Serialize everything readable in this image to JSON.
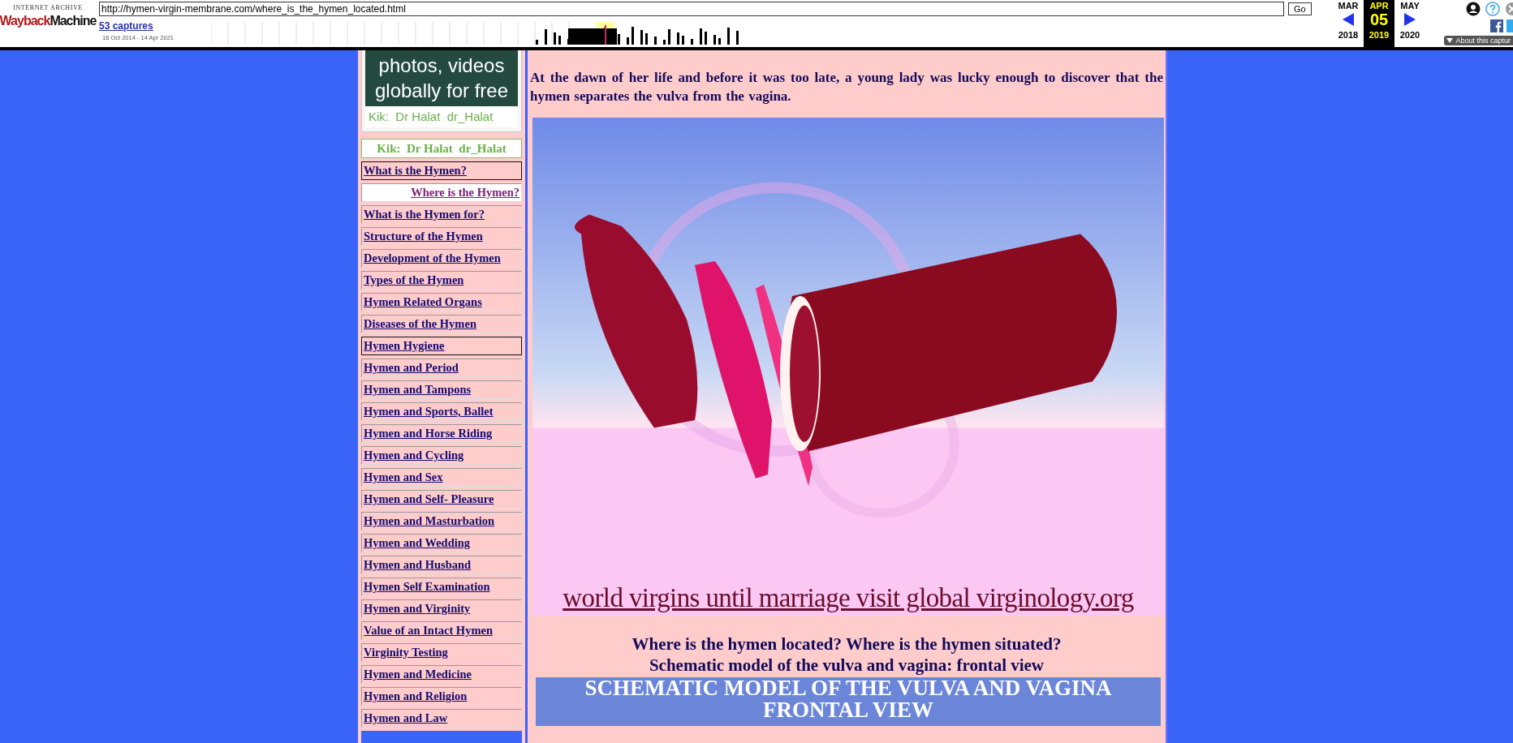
{
  "toolbar": {
    "logo_top": "INTERNET ARCHIVE",
    "logo_wayback": "Wayback",
    "logo_machine": "Machine",
    "url": "http://hymen-virgin-membrane.com/where_is_the_hymen_located.html",
    "go": "Go",
    "captures": "53 captures",
    "date_range": "16 Oct 2014 - 14 Apr 2021",
    "calendar": [
      {
        "month": "MAR",
        "year": "2018",
        "selected": false
      },
      {
        "month": "APR",
        "day": "05",
        "year": "2019",
        "selected": true
      },
      {
        "month": "MAY",
        "year": "2020",
        "selected": false
      }
    ],
    "about": "About this captur"
  },
  "sidebar": {
    "ad_lines": [
      "photos, videos",
      "globally for free"
    ],
    "ad_contact": "Kik:  Dr Halat  dr_Halat",
    "contact": "Kik:  Dr Halat  dr_Halat",
    "items": [
      {
        "label": "What is the Hymen?",
        "selected": false,
        "outlined": true
      },
      {
        "label": "Where is the Hymen?",
        "selected": true,
        "outlined": false
      },
      {
        "label": "What is the Hymen for?",
        "selected": false,
        "outlined": false
      },
      {
        "label": "Structure of the Hymen",
        "selected": false,
        "outlined": false
      },
      {
        "label": "Development of the Hymen",
        "selected": false,
        "outlined": false
      },
      {
        "label": "Types of the Hymen",
        "selected": false,
        "outlined": false
      },
      {
        "label": "Hymen Related Organs",
        "selected": false,
        "outlined": false
      },
      {
        "label": "Diseases of the Hymen",
        "selected": false,
        "outlined": false
      },
      {
        "label": "Hymen Hygiene",
        "selected": false,
        "outlined": true
      },
      {
        "label": "Hymen and Period",
        "selected": false,
        "outlined": false
      },
      {
        "label": "Hymen and Tampons",
        "selected": false,
        "outlined": false
      },
      {
        "label": "Hymen and Sports, Ballet",
        "selected": false,
        "outlined": false
      },
      {
        "label": "Hymen and Horse Riding",
        "selected": false,
        "outlined": false
      },
      {
        "label": "Hymen and Cycling",
        "selected": false,
        "outlined": false
      },
      {
        "label": "Hymen and Sex",
        "selected": false,
        "outlined": false
      },
      {
        "label": "Hymen and Self- Pleasure",
        "selected": false,
        "outlined": false
      },
      {
        "label": "Hymen and Masturbation",
        "selected": false,
        "outlined": false
      },
      {
        "label": "Hymen and Wedding",
        "selected": false,
        "outlined": false
      },
      {
        "label": "Hymen and Husband",
        "selected": false,
        "outlined": false
      },
      {
        "label": "Hymen Self Examination",
        "selected": false,
        "outlined": false
      },
      {
        "label": "Hymen and Virginity",
        "selected": false,
        "outlined": false
      },
      {
        "label": "Value of an Intact Hymen",
        "selected": false,
        "outlined": false
      },
      {
        "label": "Virginity Testing",
        "selected": false,
        "outlined": false
      },
      {
        "label": "Hymen and Medicine",
        "selected": false,
        "outlined": false
      },
      {
        "label": "Hymen and Religion",
        "selected": false,
        "outlined": false
      },
      {
        "label": "Hymen and Law",
        "selected": false,
        "outlined": false
      }
    ]
  },
  "content": {
    "intro": "At the dawn of her life and before it was too late, a young lady was lucky enough to discover that the hymen separates the vulva from the vagina.",
    "image": {
      "kind": "picture"
    },
    "image_caption": "world virgins until marriage visit global virginology.org",
    "headings": [
      "Where is the hymen located? Where is the hymen situated?",
      "Schematic model of the vulva and vagina: frontal view"
    ],
    "banner_lines": [
      "SCHEMATIC MODEL OF THE VULVA AND VAGINA",
      "FRONTAL VIEW"
    ]
  }
}
